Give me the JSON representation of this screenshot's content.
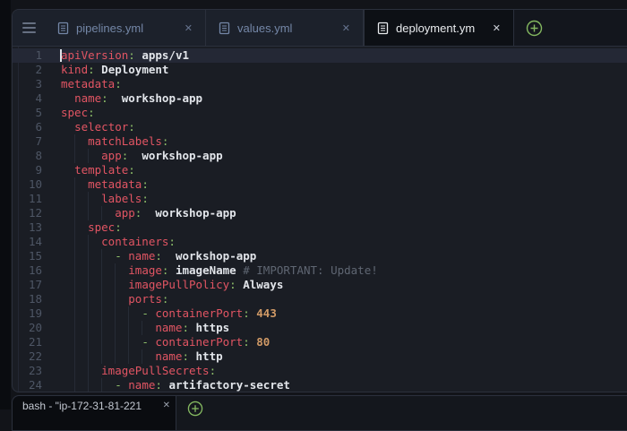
{
  "window": {
    "tab_bar": {
      "menu_icon": "hamburger",
      "tabs": [
        {
          "label": "pipelines.yml",
          "close_icon": "✕",
          "active": false
        },
        {
          "label": "values.yml",
          "close_icon": "✕",
          "active": false
        },
        {
          "label": "deployment.yml",
          "close_icon": "✕",
          "active": true
        }
      ],
      "new_tab_icon": "plus-circle"
    },
    "editor": {
      "language": "yaml",
      "cursor": {
        "line": 1,
        "col": 0
      },
      "lines": [
        {
          "n": 1,
          "i": 0,
          "t": [
            [
              "k",
              "apiVersion"
            ],
            [
              "p",
              ":"
            ],
            [
              "s",
              " "
            ],
            [
              "v",
              "apps/v1"
            ]
          ]
        },
        {
          "n": 2,
          "i": 0,
          "t": [
            [
              "k",
              "kind"
            ],
            [
              "p",
              ":"
            ],
            [
              "s",
              " "
            ],
            [
              "v",
              "Deployment"
            ]
          ]
        },
        {
          "n": 3,
          "i": 0,
          "t": [
            [
              "k",
              "metadata"
            ],
            [
              "p",
              ":"
            ]
          ]
        },
        {
          "n": 4,
          "i": 2,
          "t": [
            [
              "k",
              "name"
            ],
            [
              "p",
              ":"
            ],
            [
              "s",
              "  "
            ],
            [
              "v",
              "workshop-app"
            ]
          ]
        },
        {
          "n": 5,
          "i": 0,
          "t": [
            [
              "k",
              "spec"
            ],
            [
              "p",
              ":"
            ]
          ]
        },
        {
          "n": 6,
          "i": 2,
          "t": [
            [
              "k",
              "selector"
            ],
            [
              "p",
              ":"
            ]
          ]
        },
        {
          "n": 7,
          "i": 4,
          "t": [
            [
              "k",
              "matchLabels"
            ],
            [
              "p",
              ":"
            ]
          ]
        },
        {
          "n": 8,
          "i": 6,
          "t": [
            [
              "k",
              "app"
            ],
            [
              "p",
              ":"
            ],
            [
              "s",
              "  "
            ],
            [
              "v",
              "workshop-app"
            ]
          ]
        },
        {
          "n": 9,
          "i": 2,
          "t": [
            [
              "k",
              "template"
            ],
            [
              "p",
              ":"
            ]
          ]
        },
        {
          "n": 10,
          "i": 4,
          "t": [
            [
              "k",
              "metadata"
            ],
            [
              "p",
              ":"
            ]
          ]
        },
        {
          "n": 11,
          "i": 6,
          "t": [
            [
              "k",
              "labels"
            ],
            [
              "p",
              ":"
            ]
          ]
        },
        {
          "n": 12,
          "i": 8,
          "t": [
            [
              "k",
              "app"
            ],
            [
              "p",
              ":"
            ],
            [
              "s",
              "  "
            ],
            [
              "v",
              "workshop-app"
            ]
          ]
        },
        {
          "n": 13,
          "i": 4,
          "t": [
            [
              "k",
              "spec"
            ],
            [
              "p",
              ":"
            ]
          ]
        },
        {
          "n": 14,
          "i": 6,
          "t": [
            [
              "k",
              "containers"
            ],
            [
              "p",
              ":"
            ]
          ]
        },
        {
          "n": 15,
          "i": 8,
          "t": [
            [
              "d",
              "- "
            ],
            [
              "k",
              "name"
            ],
            [
              "p",
              ":"
            ],
            [
              "s",
              "  "
            ],
            [
              "v",
              "workshop-app"
            ]
          ]
        },
        {
          "n": 16,
          "i": 10,
          "t": [
            [
              "k",
              "image"
            ],
            [
              "p",
              ":"
            ],
            [
              "s",
              " "
            ],
            [
              "v",
              "imageName"
            ],
            [
              "s",
              " "
            ],
            [
              "c",
              "# IMPORTANT: Update!"
            ]
          ]
        },
        {
          "n": 17,
          "i": 10,
          "t": [
            [
              "k",
              "imagePullPolicy"
            ],
            [
              "p",
              ":"
            ],
            [
              "s",
              " "
            ],
            [
              "v",
              "Always"
            ]
          ]
        },
        {
          "n": 18,
          "i": 10,
          "t": [
            [
              "k",
              "ports"
            ],
            [
              "p",
              ":"
            ]
          ]
        },
        {
          "n": 19,
          "i": 12,
          "t": [
            [
              "d",
              "- "
            ],
            [
              "k",
              "containerPort"
            ],
            [
              "p",
              ":"
            ],
            [
              "s",
              " "
            ],
            [
              "n",
              "443"
            ]
          ]
        },
        {
          "n": 20,
          "i": 14,
          "t": [
            [
              "k",
              "name"
            ],
            [
              "p",
              ":"
            ],
            [
              "s",
              " "
            ],
            [
              "v",
              "https"
            ]
          ]
        },
        {
          "n": 21,
          "i": 12,
          "t": [
            [
              "d",
              "- "
            ],
            [
              "k",
              "containerPort"
            ],
            [
              "p",
              ":"
            ],
            [
              "s",
              " "
            ],
            [
              "n",
              "80"
            ]
          ]
        },
        {
          "n": 22,
          "i": 14,
          "t": [
            [
              "k",
              "name"
            ],
            [
              "p",
              ":"
            ],
            [
              "s",
              " "
            ],
            [
              "v",
              "http"
            ]
          ]
        },
        {
          "n": 23,
          "i": 6,
          "t": [
            [
              "k",
              "imagePullSecrets"
            ],
            [
              "p",
              ":"
            ]
          ]
        },
        {
          "n": 24,
          "i": 8,
          "t": [
            [
              "d",
              "- "
            ],
            [
              "k",
              "name"
            ],
            [
              "p",
              ":"
            ],
            [
              "s",
              " "
            ],
            [
              "v",
              "artifactory-secret"
            ]
          ]
        }
      ]
    },
    "terminal": {
      "tab_label": "bash - \"ip-172-31-81-221",
      "close_icon": "✕",
      "new_tab_icon": "plus-circle"
    }
  },
  "theme": {
    "editor_bg": "#1a1d24",
    "tabbar_bg": "#1c212b",
    "active_tab_bg": "#0d1015",
    "card_border": "#2b303c",
    "current_line_bg": "#242835",
    "line_number_color": "#4e5665",
    "inactive_tab_color": "#7487a7",
    "active_tab_color": "#e9ebee",
    "key_color": "#e25563",
    "punct_color": "#8fc06a",
    "value_color": "#e2e5ea",
    "number_color": "#d19a66",
    "comment_color": "#5f6672",
    "accent_green": "#84b860"
  }
}
